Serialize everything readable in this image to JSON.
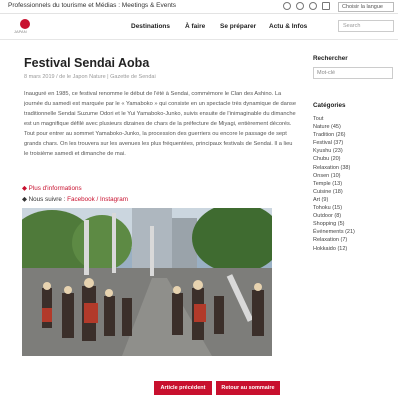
{
  "topbar": {
    "tagline": "Professionnels du tourisme et Médias : Meetings & Events",
    "language_select": "Choisir la langue"
  },
  "nav": {
    "items": [
      "Destinations",
      "À faire",
      "Se préparer",
      "Actu & Infos"
    ],
    "search_placeholder": "Search"
  },
  "article": {
    "title": "Festival Sendai Aoba",
    "meta": "8 mars 2019 / de le Japon Nature | Gazette de Sendai",
    "body": "Inauguré en 1985, ce festival renomme le début de l'été à Sendai, commémore le Clan des Ashino. La journée du samedi est marquée par le « Yamaboko » qui consiste en un spectacle très dynamique de danse traditionnelle Sendai Suzume Odori et le Yui Yamaboko-Junko, suivis ensuite de l'inimaginable du dimanche est un magnifique défilé avec plusieurs dizaines de chars de la préfecture de Miyagi, entièrement décorés. Tout pour entrer au sommet Yamaboko-Junko, la procession des guerriers ou encore le passage de sept grands chars. On les trouvera sur les avenues les plus fréquentées, principaux festivals de Sendai. Il a lieu le troisième samedi et dimanche de mai.",
    "link_info": "Plus d'informations",
    "social_prefix": "Nous suivre : ",
    "social_links": "Facebook / Instagram"
  },
  "buttons": {
    "previous": "Article précédent",
    "back": "Retour au sommaire"
  },
  "sidebar": {
    "search_title": "Rechercher",
    "search_value": "Mot-clé",
    "categories_title": "Catégories",
    "categories": [
      "Tout",
      "Nature (45)",
      "Tradition (26)",
      "Festival (37)",
      "Kyushu (23)",
      "Chubu (20)",
      "Relaxation (38)",
      "Onsen (10)",
      "Temple (13)",
      "Cuisine (18)",
      "Art (9)",
      "Tohoku (15)",
      "Outdoor (8)",
      "Shopping (5)",
      "Événements (21)",
      "Relaxation (7)",
      "Hokkaido (12)"
    ]
  },
  "colors": {
    "accent": "#c8102e"
  }
}
